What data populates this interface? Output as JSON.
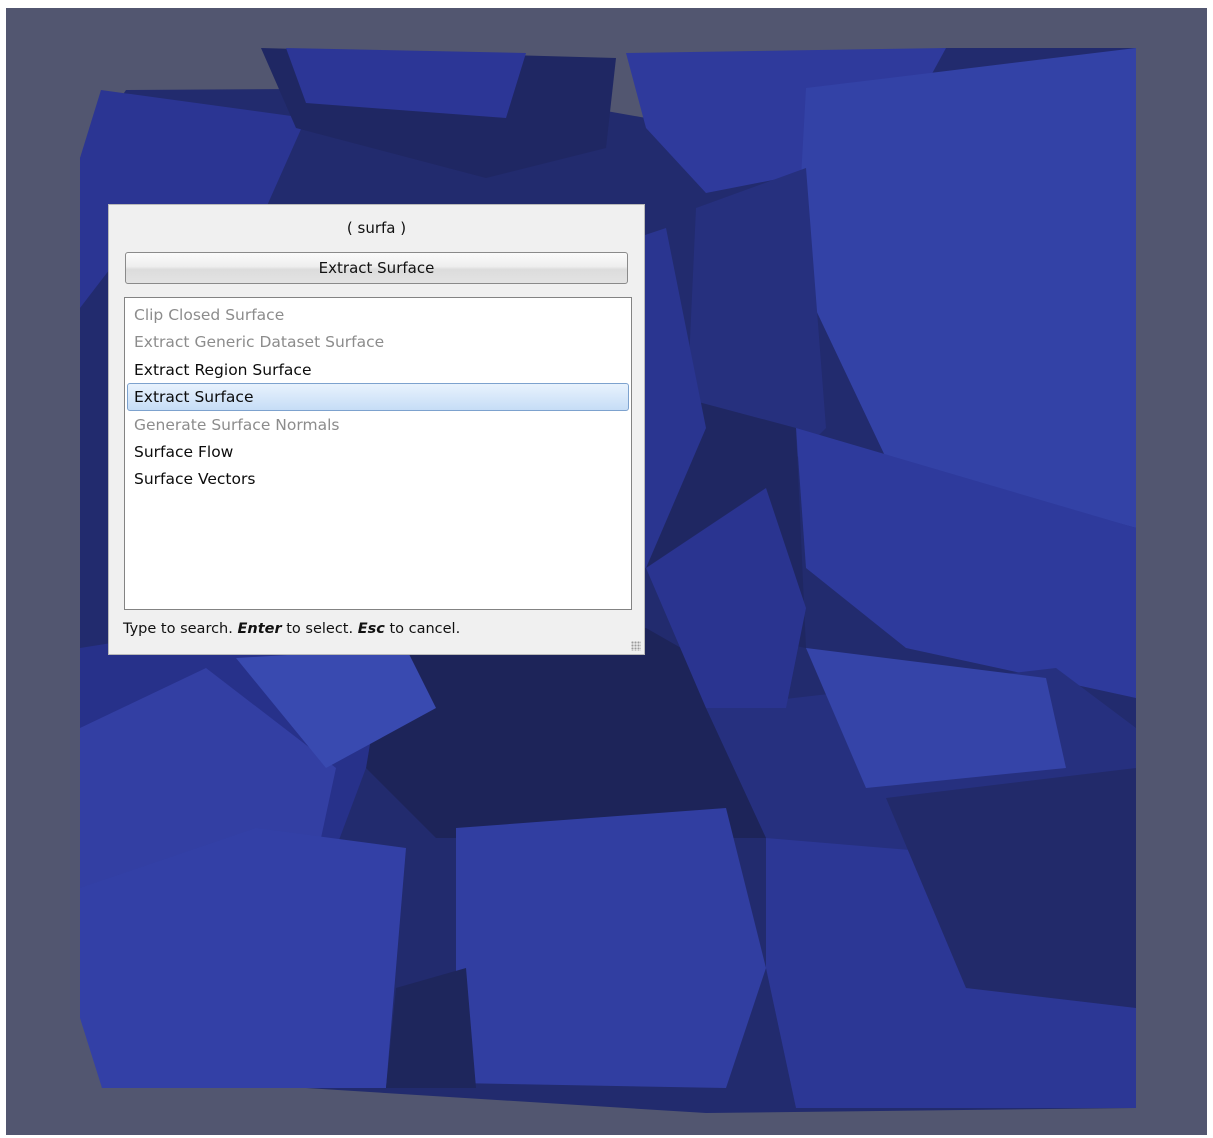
{
  "colors": {
    "background": "#525670",
    "mesh_dark": "#1c2358",
    "mesh_mid": "#2a3590",
    "mesh_light": "#3544a8",
    "selection": "#c6ddf6"
  },
  "finder": {
    "query": "( surfa )",
    "action_label": "Extract Surface",
    "results": [
      {
        "label": "Clip Closed Surface",
        "enabled": false,
        "selected": false
      },
      {
        "label": "Extract Generic Dataset Surface",
        "enabled": false,
        "selected": false
      },
      {
        "label": "Extract Region Surface",
        "enabled": true,
        "selected": false
      },
      {
        "label": "Extract Surface",
        "enabled": true,
        "selected": true
      },
      {
        "label": "Generate Surface Normals",
        "enabled": false,
        "selected": false
      },
      {
        "label": "Surface Flow",
        "enabled": true,
        "selected": false
      },
      {
        "label": "Surface Vectors",
        "enabled": true,
        "selected": false
      }
    ],
    "hint": {
      "prefix": "Type to search. ",
      "enter_key": "Enter",
      "enter_text": " to select. ",
      "esc_key": "Esc",
      "esc_text": " to cancel."
    }
  }
}
